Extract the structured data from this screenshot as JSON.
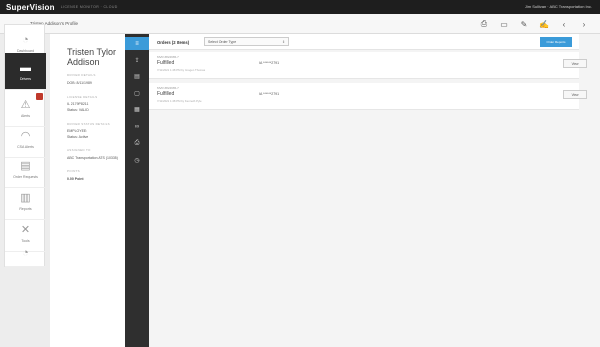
{
  "topbar": {
    "logo": "SuperVision",
    "logo_sub": "LICENSE MONITOR · CLOUD",
    "user": "Jim Sullivan · ABC Transportation Inc."
  },
  "titlebar": {
    "title": "Tristen Addison's Profile",
    "tool_icons": [
      "print-icon",
      "window-icon",
      "edit-icon",
      "signature-icon",
      "prev-icon",
      "next-icon"
    ]
  },
  "sidebar": {
    "items": [
      {
        "label": "Dashboard",
        "icon": "dashboard-icon",
        "active": false
      },
      {
        "label": "Drivers",
        "icon": "drivers-icon",
        "active": true
      },
      {
        "label": "Alerts",
        "icon": "alerts-icon",
        "active": false
      },
      {
        "label": "CSA Alerts",
        "icon": "csa-gauge-icon",
        "active": false
      },
      {
        "label": "Order Requests",
        "icon": "order-icon",
        "active": false
      },
      {
        "label": "Reports",
        "icon": "reports-icon",
        "active": false
      },
      {
        "label": "Tools",
        "icon": "tools-icon",
        "active": false
      },
      {
        "label": "",
        "icon": "gauge-icon",
        "active": false
      }
    ]
  },
  "profile": {
    "first_name": "Tristen Tylor",
    "last_name": "Addison",
    "sections": [
      {
        "label": "DRIVER DETAILS",
        "value": "DOB: 8/11/1989"
      },
      {
        "label": "LICENSE DETAILS",
        "value": "IL 2179P8211"
      },
      {
        "label": "",
        "value": "Status: VALID"
      },
      {
        "label": "DRIVER STATUS DETAILS",
        "value": "EMPLOYEE:"
      },
      {
        "label": "",
        "value": "Status: Active"
      },
      {
        "label": "ASSIGNED TO",
        "value": "ABC Transportation ATS (10335)"
      },
      {
        "label": "POINTS",
        "value": "0.00 Point"
      }
    ]
  },
  "orders": {
    "title": "Orders (2 Items)",
    "filter_placeholder": "Select Order Type",
    "order_button": "Order Reports",
    "rows": [
      {
        "id": "MVR #824965-7",
        "status": "Fulfilled",
        "meta": "7/11/2021 1:48 PM by Imogen Thomas",
        "number": "IA ******2791",
        "action": "View"
      },
      {
        "id": "MVR #824965-7",
        "status": "Fulfilled",
        "meta": "7/11/2021 1:48 PM by Kenneth Pyle",
        "number": "IA ******2791",
        "action": "View"
      }
    ]
  }
}
